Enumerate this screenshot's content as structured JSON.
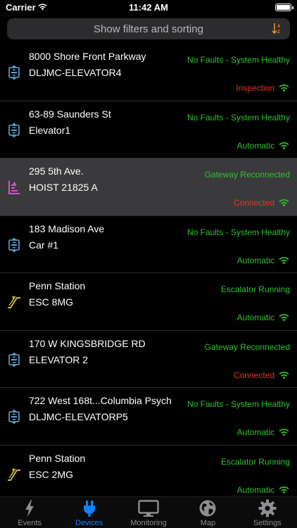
{
  "status_bar": {
    "carrier": "Carrier",
    "time": "11:42 AM"
  },
  "filter_bar": {
    "label": "Show filters and sorting"
  },
  "colors": {
    "ok": "#2fc22f",
    "alert": "#e0362c",
    "elevator_icon": "#5aa6d6",
    "hoist_icon": "#d94fd0",
    "escalator_icon": "#c9b63a",
    "active_tab": "#0a84ff"
  },
  "devices": [
    {
      "address": "8000 Shore Front Parkway",
      "name": "DLJMC-ELEVATOR4",
      "status": "No Faults - System Healthy",
      "mode": "Inspection",
      "mode_alert": true,
      "icon": "elevator-icon"
    },
    {
      "address": "63-89 Saunders St",
      "name": "Elevator1",
      "status": "No Faults - System Healthy",
      "mode": "Automatic",
      "mode_alert": false,
      "icon": "elevator-icon"
    },
    {
      "address": "295 5th Ave.",
      "name": "HOIST 21825 A",
      "status": "Gateway Reconnected",
      "mode": "Connected",
      "mode_alert": true,
      "icon": "hoist-icon",
      "selected": true
    },
    {
      "address": "183 Madison Ave",
      "name": "Car #1",
      "status": "No Faults - System Healthy",
      "mode": "Automatic",
      "mode_alert": false,
      "icon": "elevator-icon"
    },
    {
      "address": "Penn Station",
      "name": "ESC 8MG",
      "status": "Escalator Running",
      "mode": "Automatic",
      "mode_alert": false,
      "icon": "escalator-icon"
    },
    {
      "address": "170 W KINGSBRIDGE RD",
      "name": "ELEVATOR 2",
      "status": "Gateway Reconnected",
      "mode": "Connected",
      "mode_alert": true,
      "icon": "elevator-icon"
    },
    {
      "address": "722 West 168t...Columbia Psych",
      "name": "DLJMC-ELEVATORP5",
      "status": "No Faults - System Healthy",
      "mode": "Automatic",
      "mode_alert": false,
      "icon": "elevator-icon"
    },
    {
      "address": "Penn Station",
      "name": "ESC 2MG",
      "status": "Escalator Running",
      "mode": "Automatic",
      "mode_alert": false,
      "icon": "escalator-icon"
    }
  ],
  "tabs": [
    {
      "label": "Events",
      "icon": "lightning-icon",
      "active": false
    },
    {
      "label": "Devices",
      "icon": "plug-icon",
      "active": true
    },
    {
      "label": "Monitoring",
      "icon": "monitor-icon",
      "active": false
    },
    {
      "label": "Map",
      "icon": "globe-icon",
      "active": false
    },
    {
      "label": "Settings",
      "icon": "gear-icon",
      "active": false
    }
  ]
}
